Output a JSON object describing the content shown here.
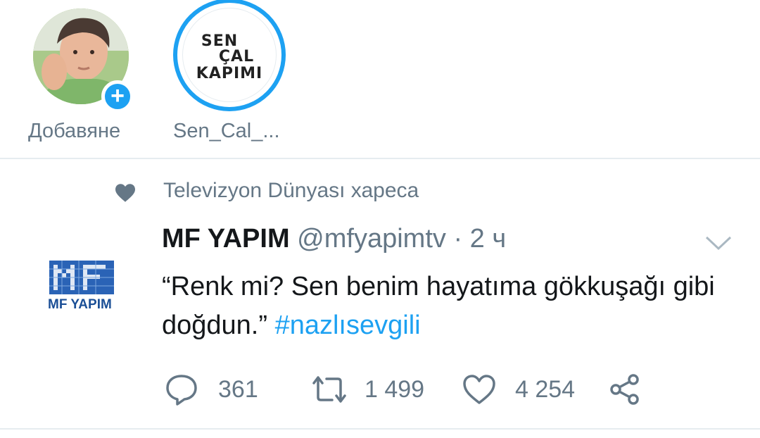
{
  "stories": {
    "own": {
      "label": "Добавяне",
      "add_glyph": "+",
      "icon": "add-story-icon"
    },
    "channel": {
      "label": "Sen_Cal_...",
      "logo_lines": [
        "SEN",
        "ÇAL",
        "KAPIMI"
      ]
    }
  },
  "tweet": {
    "retweet_context": "Televizyon Dünyası харесa",
    "author_name": "MF YAPIM",
    "author_handle": "@mfyapimtv",
    "separator": "·",
    "time": "2 ч",
    "logo_label": "MF YAPIM",
    "text": "“Renk mi? Sen benim hayatıma gökkuşağı gibi doğdun.”",
    "hashtag": "#nazlısevgili",
    "actions": {
      "replies": "361",
      "retweets": "1 499",
      "likes": "4 254"
    }
  },
  "colors": {
    "accent": "#1da1f2",
    "muted": "#657786",
    "divider": "#e6ecf0"
  }
}
